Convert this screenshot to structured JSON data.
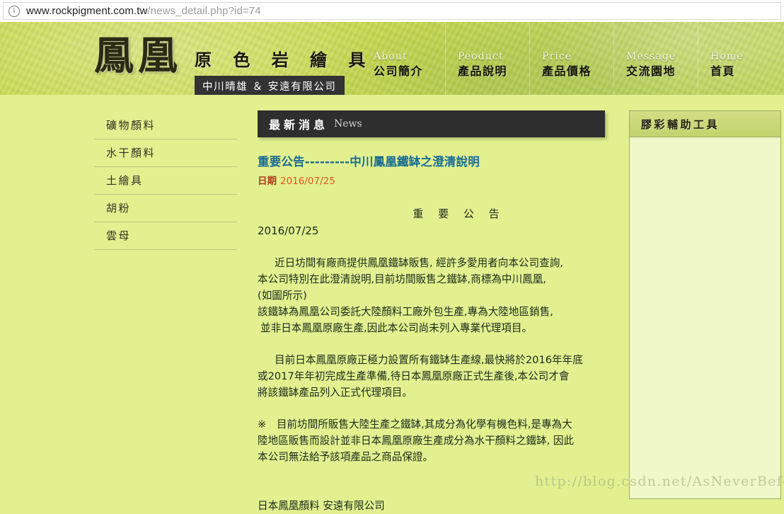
{
  "browser": {
    "info_icon": "info-circle-icon",
    "url_main": "www.rockpigment.com.tw",
    "url_path": "/news_detail.php?id=74"
  },
  "banner": {
    "logo_seal": "鳳凰",
    "logo_title": "原 色 岩 繪 具",
    "logo_sub": "中川晴雄 ＆ 安遠有限公司",
    "nav": [
      {
        "en": "About",
        "zh": "公司簡介"
      },
      {
        "en": "Peoduct",
        "zh": "產品說明"
      },
      {
        "en": "Price",
        "zh": "產品價格"
      },
      {
        "en": "Message",
        "zh": "交流園地"
      },
      {
        "en": "Home",
        "zh": "首頁"
      }
    ]
  },
  "sidebar": {
    "items": [
      {
        "label": "礦物顏料"
      },
      {
        "label": "水干顏料"
      },
      {
        "label": "土繪具"
      },
      {
        "label": "胡粉"
      },
      {
        "label": "雲母"
      }
    ]
  },
  "main": {
    "news_header_zh": "最新消息",
    "news_header_en": "News",
    "article_title": "重要公告---------中川鳳凰鐵缽之澄清說明",
    "date_label": "日期",
    "date_value": "2016/07/25",
    "doc_heading": "重 要 公 告",
    "doc_date": "2016/07/25",
    "paragraph1": {
      "line1": "近日坊間有廠商提供鳳凰鐵缽販售, 經許多愛用者向本公司查詢,",
      "line2": "本公司特別在此澄清說明,目前坊間販售之鐵缽,商標為中川鳳凰,",
      "line3": "(如圖所示)",
      "line4": "該鐵缽為鳳凰公司委託大陸顏料工廠外包生產,專為大陸地區銷售,",
      "line5": "並非日本鳳凰原廠生產,因此本公司尚未列入專業代理項目。"
    },
    "paragraph2": {
      "line1": "目前日本鳳凰原廠正極力設置所有鐵缽生產線,最快將於2016年年底",
      "line2": "或2017年年初完成生產準備,待日本鳳凰原廠正式生產後,本公司才會",
      "line3": "將該鐵缽產品列入正式代理項目。"
    },
    "paragraph3": {
      "line1": "※　目前坊間所販售大陸生產之鐵缽,其成分為化學有機色料,是專為大",
      "line2": "陸地區販售而設計並非日本鳳凰原廠生產成分為水干顏料之鐵缽, 因此",
      "line3": "本公司無法給予該項產品之商品保證。"
    },
    "footer_sign": "日本鳳凰顏料 安遠有限公司"
  },
  "right_panel": {
    "title": "膠彩輔助工具"
  },
  "watermark": {
    "text": "http://blog.csdn.net/AsNeverBefore"
  },
  "colors": {
    "page_bg": "#e2f090",
    "banner_green": "#c7d94a",
    "news_bar": "#2e2e2e",
    "title_link": "#1a6d92",
    "date_value": "#e2561a",
    "panel_bg": "#f0f7c9"
  }
}
